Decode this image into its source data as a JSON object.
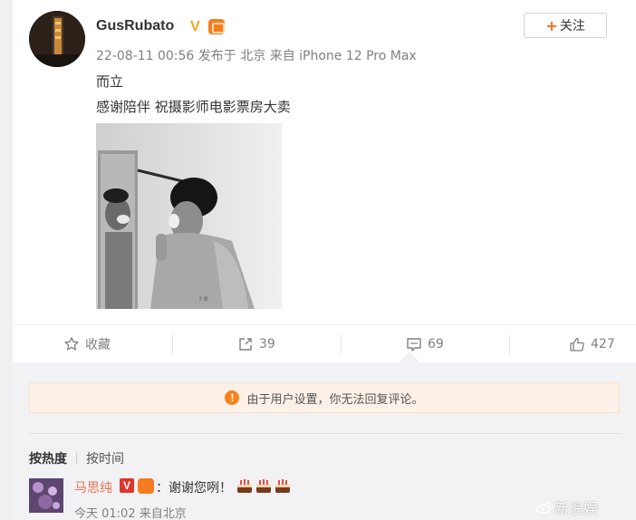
{
  "post": {
    "username": "GusRubato",
    "verified_badge": "V",
    "follow_plus": "+",
    "follow_label": "关注",
    "meta": "22-08-11 00:56 发布于 北京 来自 iPhone 12 Pro Max",
    "text_line1": "而立",
    "text_line2": "感谢陪伴 祝摄影师电影票房大卖"
  },
  "actions": {
    "favorite_label": "收藏",
    "repost_count": "39",
    "comment_count": "69",
    "like_count": "427"
  },
  "comments": {
    "notice_icon": "!",
    "notice_text": "由于用户设置，你无法回复评论。",
    "sort_hot": "按热度",
    "sort_time": "按时间",
    "items": [
      {
        "name": "马思纯",
        "vip_badge": "V",
        "text": "：谢谢您咧！",
        "time": "今天 01:02 来自北京"
      }
    ]
  },
  "watermark": {
    "text": "新浪娱"
  },
  "colors": {
    "accent_orange": "#f76b1c",
    "username_comment": "#eb7350",
    "meta_gray": "#808080",
    "notice_bg": "#fdf1e7"
  },
  "icons": [
    "star-icon",
    "repost-icon",
    "comment-icon",
    "like-icon",
    "warning-icon",
    "cake-icon",
    "weibo-logo-icon"
  ]
}
